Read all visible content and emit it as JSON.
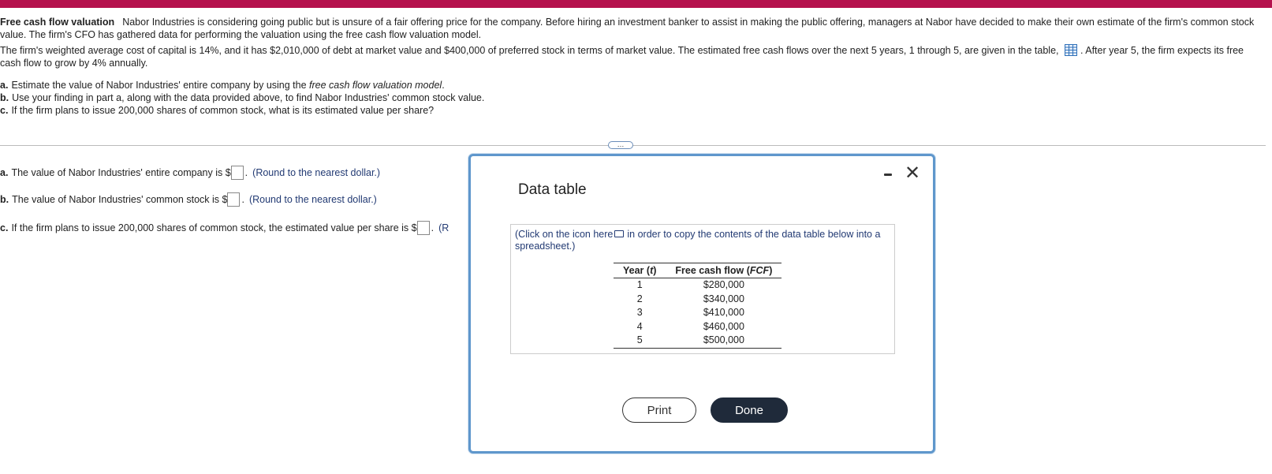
{
  "problem": {
    "title": "Free cash flow valuation",
    "intro": "Nabor Industries is considering going public but is unsure of a fair offering price for the company. Before hiring an investment banker to assist in making the public offering, managers at Nabor have decided to make their own estimate of the firm's common stock value. The firm's CFO has gathered data for performing the valuation using the free cash flow valuation model.",
    "details_before_icon": "The firm's weighted average cost of capital is 14%, and it has $2,010,000 of debt at market value and $400,000 of preferred stock in terms of market value.  The estimated free cash flows over the next 5 years, 1 through 5, are given in the table,",
    "details_after_icon": ". After year 5, the firm expects its free cash flow to grow by 4% annually.",
    "parts": [
      {
        "letter": "a.",
        "text_before": "Estimate the value of Nabor Industries' entire company by using the ",
        "italic": "free cash flow valuation model",
        "text_after": "."
      },
      {
        "letter": "b.",
        "text_before": "Use your finding in part a, along with the data provided above, to find Nabor Industries' common stock value.",
        "italic": "",
        "text_after": ""
      },
      {
        "letter": "c.",
        "text_before": "If the firm plans to issue 200,000 shares of common stock, what is its estimated value per share?",
        "italic": "",
        "text_after": ""
      }
    ]
  },
  "more_button": "…",
  "answers": [
    {
      "letter": "a.",
      "prefix": "The value of Nabor Industries' entire company is $",
      "suffix": ".",
      "hint": "(Round to the nearest dollar.)"
    },
    {
      "letter": "b.",
      "prefix": "The value of Nabor Industries' common stock is $",
      "suffix": ".",
      "hint": "(Round to the nearest dollar.)"
    },
    {
      "letter": "c.",
      "prefix": "If the firm plans to issue 200,000 shares of common stock, the estimated value per share is $",
      "suffix": ".",
      "hint": "(R"
    }
  ],
  "modal": {
    "title": "Data table",
    "note_before_icon": "(Click on the icon here",
    "note_after_icon": "in order to copy the contents of the data table below into a spreadsheet.)",
    "table": {
      "header_year": "Year (",
      "header_year_var": "t",
      "header_year_close": ")",
      "header_fcf": "Free cash flow (",
      "header_fcf_var": "FCF",
      "header_fcf_close": ")",
      "rows": [
        {
          "year": "1",
          "fcf": "$280,000"
        },
        {
          "year": "2",
          "fcf": "$340,000"
        },
        {
          "year": "3",
          "fcf": "$410,000"
        },
        {
          "year": "4",
          "fcf": "$460,000"
        },
        {
          "year": "5",
          "fcf": "$500,000"
        }
      ]
    },
    "print_label": "Print",
    "done_label": "Done"
  },
  "colors": {
    "top_bar": "#b5124d",
    "modal_border": "#5f97cc",
    "hint_text": "#223a73",
    "done_button": "#1f2a3a"
  },
  "icons": [
    "table-grid-icon",
    "copy-icon",
    "minimize-icon",
    "close-icon"
  ]
}
